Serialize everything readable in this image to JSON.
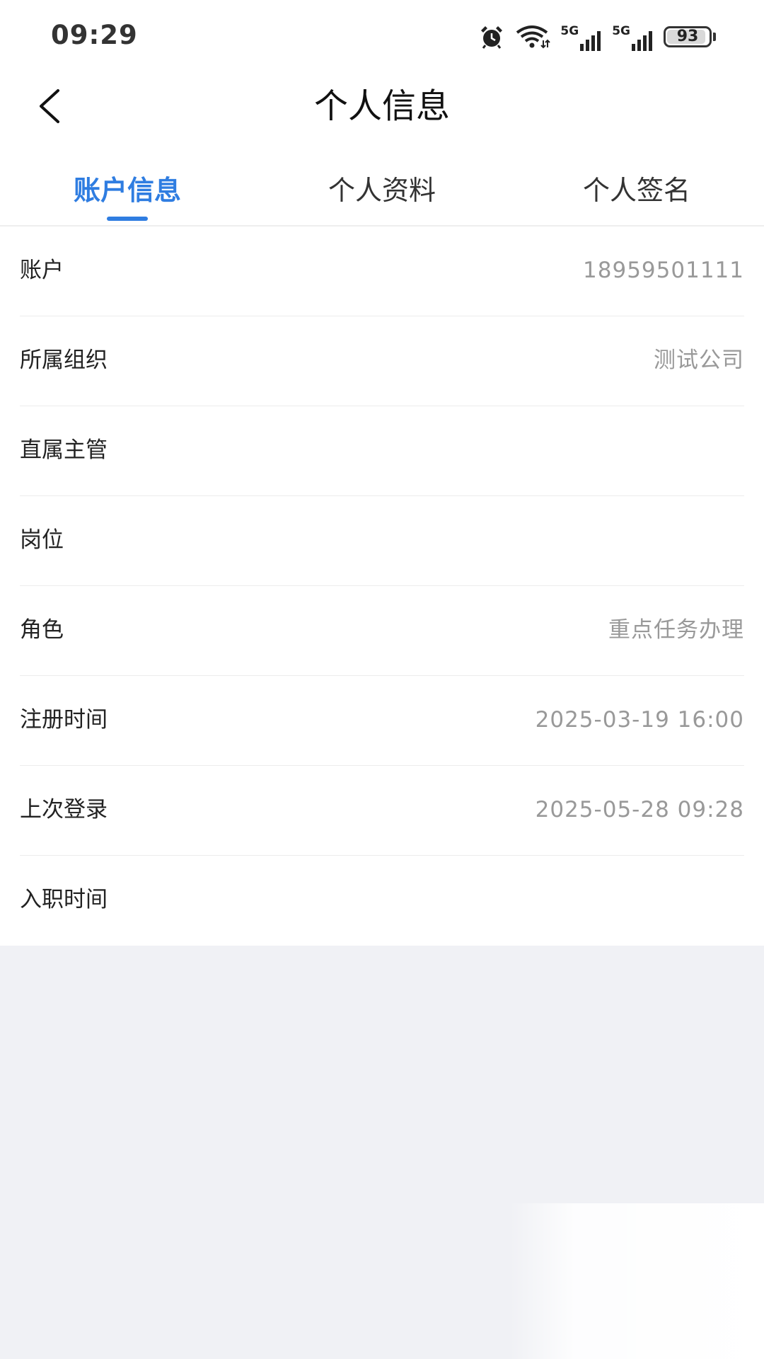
{
  "status_bar": {
    "time": "09:29",
    "network_1": "5G",
    "network_2": "5G",
    "battery_level": "93",
    "battery_fraction": 0.93
  },
  "header": {
    "title": "个人信息",
    "back_icon": "chevron-left-icon"
  },
  "tabs": [
    {
      "label": "账户信息",
      "active": true
    },
    {
      "label": "个人资料",
      "active": false
    },
    {
      "label": "个人签名",
      "active": false
    }
  ],
  "accent_color": "#2f7de1",
  "info": [
    {
      "label": "账户",
      "value": "18959501111"
    },
    {
      "label": "所属组织",
      "value": "测试公司"
    },
    {
      "label": "直属主管",
      "value": ""
    },
    {
      "label": "岗位",
      "value": ""
    },
    {
      "label": "角色",
      "value": "重点任务办理"
    },
    {
      "label": "注册时间",
      "value": "2025-03-19 16:00"
    },
    {
      "label": "上次登录",
      "value": "2025-05-28 09:28"
    },
    {
      "label": "入职时间",
      "value": ""
    }
  ]
}
